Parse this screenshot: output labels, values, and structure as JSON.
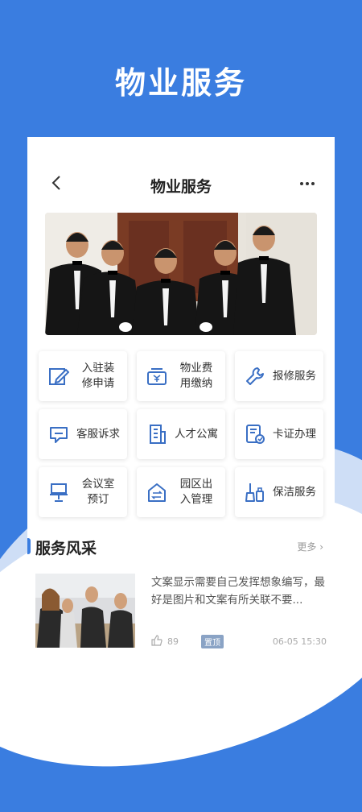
{
  "hero": {
    "title": "物业服务"
  },
  "nav": {
    "title": "物业服务"
  },
  "services": [
    {
      "label": "入驻装\n修申请",
      "icon": "edit-icon"
    },
    {
      "label": "物业费\n用缴纳",
      "icon": "payment-icon"
    },
    {
      "label": "报修服务",
      "icon": "wrench-icon"
    },
    {
      "label": "客服诉求",
      "icon": "message-icon"
    },
    {
      "label": "人才公寓",
      "icon": "apartment-icon"
    },
    {
      "label": "卡证办理",
      "icon": "card-icon"
    },
    {
      "label": "会议室\n预订",
      "icon": "meeting-room-icon"
    },
    {
      "label": "园区出\n入管理",
      "icon": "access-icon"
    },
    {
      "label": "保洁服务",
      "icon": "cleaning-icon"
    }
  ],
  "section": {
    "title": "服务风采",
    "more": "更多"
  },
  "article": {
    "text": "文案显示需要自己发挥想象编写，最好是图片和文案有所关联不要...",
    "likes": "89",
    "tag": "置顶",
    "time": "06-05 15:30"
  },
  "colors": {
    "primary": "#3a7de0",
    "icon": "#3a6fc4"
  }
}
